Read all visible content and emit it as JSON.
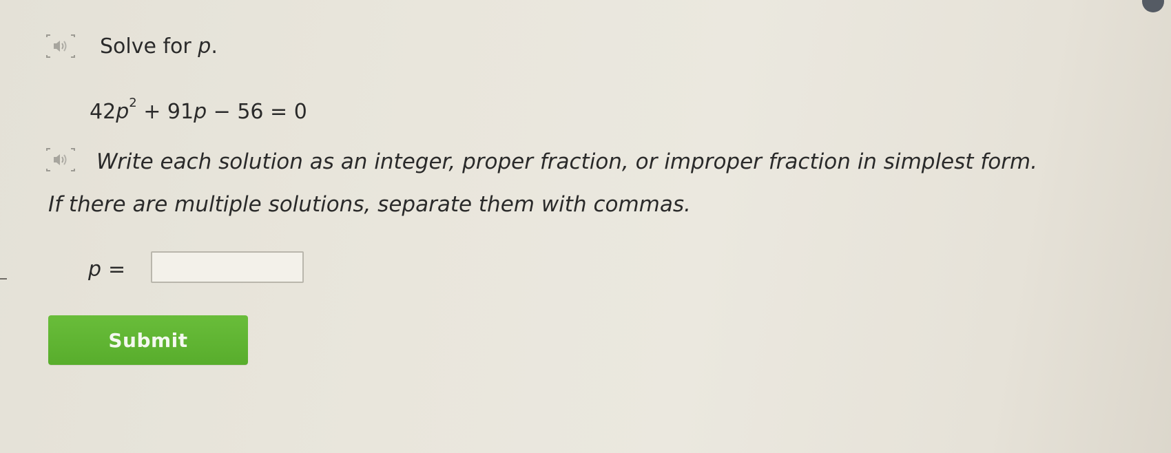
{
  "question": {
    "title": {
      "text": "Solve for ",
      "variable": "p",
      "punct": "."
    },
    "equation": {
      "coef_a": "42",
      "variable": "p",
      "exponent": "2",
      "middle": " + 91",
      "variable2": "p",
      "tail": " − 56 = 0"
    },
    "instruction": {
      "line1": "Write each solution as an integer, proper fraction, or improper fraction in simplest form.",
      "line2": "If there are multiple solutions, separate them with commas."
    },
    "answer": {
      "variable": "p",
      "equals": "=",
      "value": "",
      "placeholder": ""
    },
    "submit_label": "Submit"
  },
  "icons": {
    "title_audio": "audio-speaker-icon",
    "instruction_audio": "audio-speaker-icon"
  },
  "colors": {
    "submit_button": "#5fb332",
    "background": "#e9e6dc",
    "text": "#2a2a2a"
  }
}
